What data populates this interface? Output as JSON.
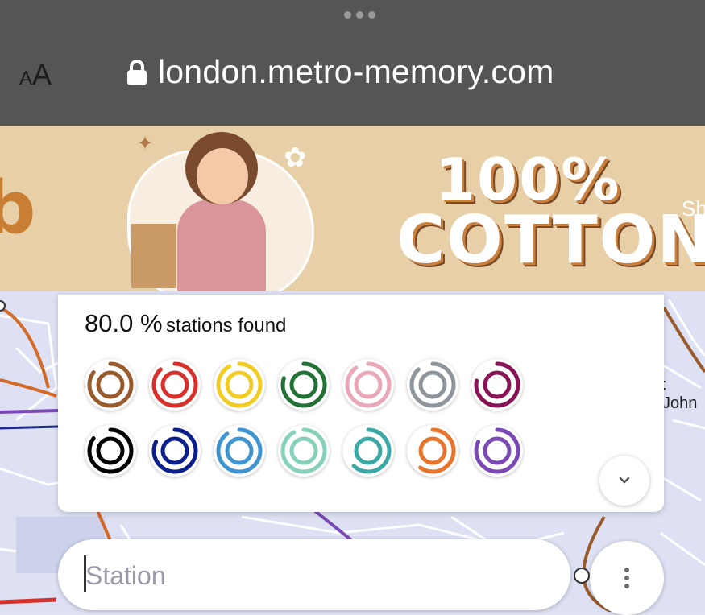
{
  "browser": {
    "text_size_label": "AA",
    "url": "london.metro-memory.com",
    "icons": [
      "more-dots-icon",
      "lock-icon"
    ]
  },
  "ad": {
    "headline_line1": "100%",
    "headline_line2": "COTTON",
    "left_partial": "b",
    "right_partial": "Sh"
  },
  "progress": {
    "percent_text": "80.0 %",
    "label": "stations found",
    "value": 80.0
  },
  "lines": [
    {
      "color": "#9a5a2c",
      "found": 0.85
    },
    {
      "color": "#d8302b",
      "found": 0.88
    },
    {
      "color": "#f2cc22",
      "found": 0.92
    },
    {
      "color": "#237235",
      "found": 0.8
    },
    {
      "color": "#e9a7b8",
      "found": 0.9
    },
    {
      "color": "#8f959c",
      "found": 0.88
    },
    {
      "color": "#8a1257",
      "found": 0.78
    },
    {
      "color": "#000000",
      "found": 0.85
    },
    {
      "color": "#0b1f8a",
      "found": 0.82
    },
    {
      "color": "#3e95d2",
      "found": 0.9
    },
    {
      "color": "#86d1bb",
      "found": 0.92
    },
    {
      "color": "#3aa9a5",
      "found": 0.62
    },
    {
      "color": "#e9742c",
      "found": 0.6
    },
    {
      "color": "#7a49b5",
      "found": 0.82
    }
  ],
  "map": {
    "visible_label": ": John"
  },
  "search": {
    "placeholder": "Station",
    "value": ""
  },
  "icons": {
    "expand": "chevron-down-icon",
    "menu": "vertical-dots-icon"
  }
}
